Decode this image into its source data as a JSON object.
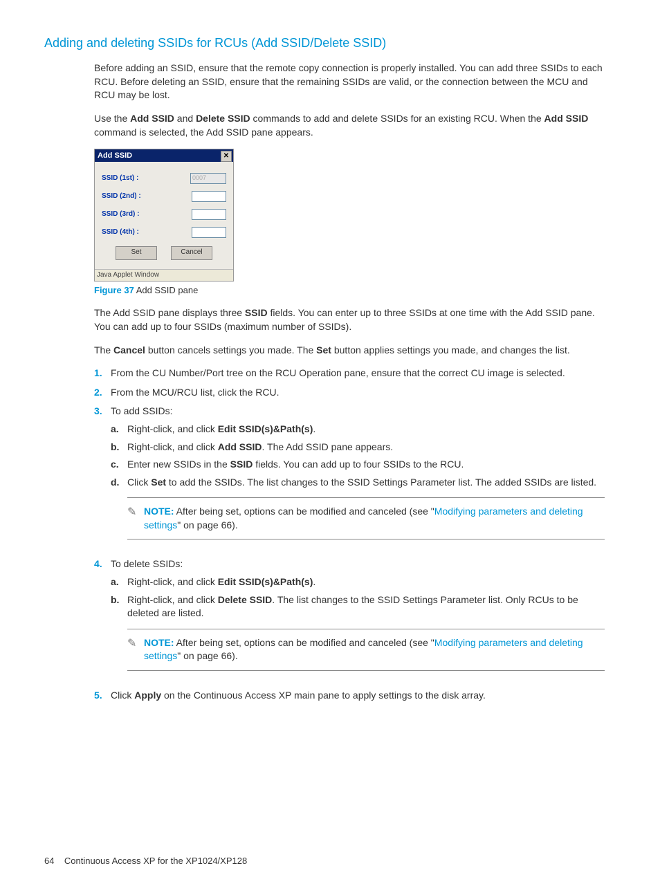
{
  "header": {
    "title": "Adding and deleting SSIDs for RCUs (Add SSID/Delete SSID)"
  },
  "intro": {
    "p1": "Before adding an SSID, ensure that the remote copy connection is properly installed. You can add three SSIDs to each RCU. Before deleting an SSID, ensure that the remaining SSIDs are valid, or the connection between the MCU and RCU may be lost.",
    "p2a": "Use the ",
    "p2b": "Add SSID",
    "p2c": " and ",
    "p2d": "Delete SSID",
    "p2e": " commands to add and delete SSIDs for an existing RCU. When the ",
    "p2f": "Add SSID",
    "p2g": " command is selected, the Add SSID pane appears."
  },
  "figure": {
    "title": "Add SSID",
    "rows": {
      "r1": "SSID (1st) :",
      "r2": "SSID (2nd) :",
      "r3": "SSID (3rd) :",
      "r4": "SSID (4th) :",
      "val1": "0007"
    },
    "btnSet": "Set",
    "btnCancel": "Cancel",
    "status": "Java Applet Window",
    "caption_num": "Figure 37",
    "caption_text": " Add SSID pane"
  },
  "after_fig": {
    "p1a": "The Add SSID pane displays three ",
    "p1b": "SSID",
    "p1c": " fields. You can enter up to three SSIDs at one time with the Add SSID pane. You can add up to four SSIDs (maximum number of SSIDs).",
    "p2a": "The ",
    "p2b": "Cancel",
    "p2c": " button cancels settings you made. The ",
    "p2d": "Set",
    "p2e": " button applies settings you made, and changes the list."
  },
  "steps": {
    "s1": "From the CU Number/Port tree on the RCU Operation pane, ensure that the correct CU image is selected.",
    "s2": "From the MCU/RCU list, click the RCU.",
    "s3": "To add SSIDs:",
    "s3a_a": "Right-click, and click ",
    "s3a_b": "Edit SSID(s)&Path(s)",
    "s3a_c": ".",
    "s3b_a": "Right-click, and click ",
    "s3b_b": "Add SSID",
    "s3b_c": ". The Add SSID pane appears.",
    "s3c_a": "Enter new SSIDs in the ",
    "s3c_b": "SSID",
    "s3c_c": " fields. You can add up to four SSIDs to the RCU.",
    "s3d_a": "Click ",
    "s3d_b": "Set",
    "s3d_c": " to add the SSIDs. The list changes to the SSID Settings Parameter list. The added SSIDs are listed.",
    "s4": "To delete SSIDs:",
    "s4a_a": "Right-click, and click ",
    "s4a_b": "Edit SSID(s)&Path(s)",
    "s4a_c": ".",
    "s4b_a": "Right-click, and click ",
    "s4b_b": "Delete SSID",
    "s4b_c": ". The list changes to the SSID Settings Parameter list. Only RCUs to be deleted are listed.",
    "s5_a": "Click ",
    "s5_b": "Apply",
    "s5_c": " on the Continuous Access XP main pane to apply settings to the disk array."
  },
  "note": {
    "label": "NOTE:",
    "text_a": "   After being set, options can be modified and canceled (see \"",
    "link": "Modifying parameters and deleting settings",
    "text_b": "\" on page 66)."
  },
  "footer": {
    "page": "64",
    "text": "Continuous Access XP for the XP1024/XP128"
  }
}
